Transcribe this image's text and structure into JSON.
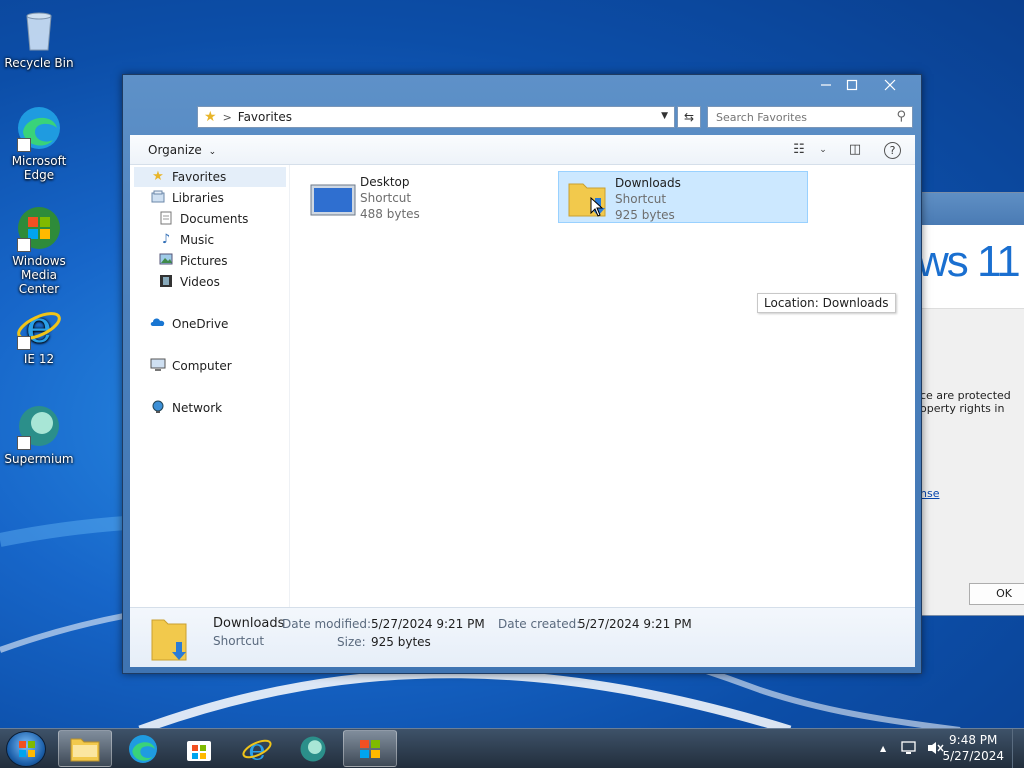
{
  "desktop": {
    "icons": [
      {
        "label": "Recycle Bin",
        "icon": "recycle-bin-icon"
      },
      {
        "label": "Microsoft Edge",
        "icon": "edge-icon"
      },
      {
        "label": "Windows Media Center",
        "icon": "media-center-icon"
      },
      {
        "label": "IE 12",
        "icon": "ie-icon"
      },
      {
        "label": "Supermium",
        "icon": "supermium-icon"
      }
    ]
  },
  "background_dialog": {
    "banner_text": "ws 11",
    "body_line1": "ce are protected",
    "body_line2": "operty rights in",
    "link_text": "nse",
    "ok_label": "OK"
  },
  "explorer": {
    "address": {
      "path": "Favorites",
      "separator": ">"
    },
    "search_placeholder": "Search Favorites",
    "toolbar": {
      "organize_label": "Organize",
      "help_glyph": "?"
    },
    "nav": [
      {
        "label": "Favorites",
        "icon": "star-icon"
      },
      {
        "label": "Libraries",
        "icon": "libraries-icon"
      },
      {
        "label": "Documents",
        "icon": "documents-icon"
      },
      {
        "label": "Music",
        "icon": "music-icon"
      },
      {
        "label": "Pictures",
        "icon": "pictures-icon"
      },
      {
        "label": "Videos",
        "icon": "videos-icon"
      },
      {
        "label": "OneDrive",
        "icon": "onedrive-icon"
      },
      {
        "label": "Computer",
        "icon": "computer-icon"
      },
      {
        "label": "Network",
        "icon": "network-icon"
      }
    ],
    "files": [
      {
        "name": "Desktop",
        "type": "Shortcut",
        "size": "488 bytes",
        "icon": "desktop-shortcut-icon"
      },
      {
        "name": "Downloads",
        "type": "Shortcut",
        "size": "925 bytes",
        "icon": "downloads-folder-icon"
      }
    ],
    "tooltip": "Location: Downloads",
    "details": {
      "name": "Downloads",
      "type": "Shortcut",
      "date_modified_label": "Date modified:",
      "date_modified": "5/27/2024 9:21 PM",
      "date_created_label": "Date created:",
      "date_created": "5/27/2024 9:21 PM",
      "size_label": "Size:",
      "size": "925 bytes"
    }
  },
  "taskbar": {
    "time": "9:48 PM",
    "date": "5/27/2024",
    "tray_arrow": "▲"
  },
  "colors": {
    "accent": "#1a6fd0",
    "selection": "#cce8ff",
    "folder": "#f2c94c"
  }
}
